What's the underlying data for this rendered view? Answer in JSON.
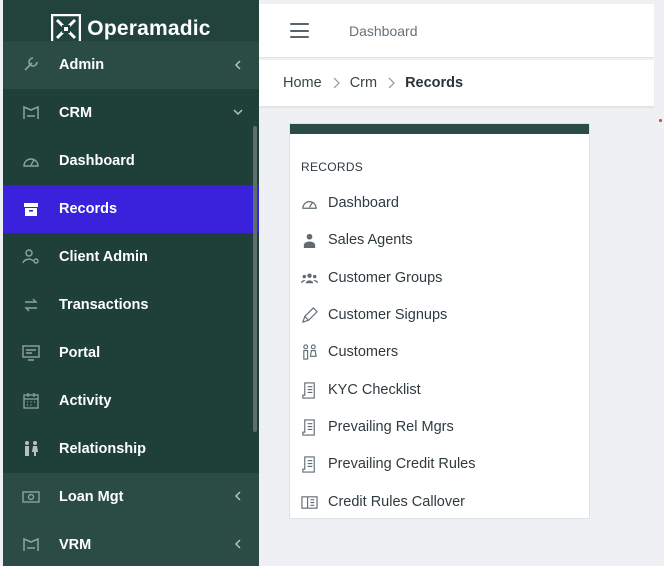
{
  "brand": {
    "name": "Operamadic"
  },
  "colors": {
    "sidebar_bg": "#1f3f39",
    "active_bg": "#3a21dc",
    "accent_bar": "#2a4c45"
  },
  "sidebar": {
    "items": [
      {
        "label": "Admin",
        "icon": "wrench-icon",
        "chevron": "left"
      },
      {
        "label": "CRM",
        "icon": "crm-icon",
        "chevron": "down"
      },
      {
        "label": "Dashboard",
        "icon": "gauge-icon"
      },
      {
        "label": "Records",
        "icon": "archive-icon",
        "active": true
      },
      {
        "label": "Client Admin",
        "icon": "user-gear-icon"
      },
      {
        "label": "Transactions",
        "icon": "arrows-exchange-icon"
      },
      {
        "label": "Portal",
        "icon": "portal-icon"
      },
      {
        "label": "Activity",
        "icon": "calendar-icon"
      },
      {
        "label": "Relationship",
        "icon": "people-icon"
      },
      {
        "label": "Loan Mgt",
        "icon": "cash-icon",
        "chevron": "left"
      },
      {
        "label": "VRM",
        "icon": "vrm-icon",
        "chevron": "left"
      }
    ]
  },
  "topbar": {
    "title": "Dashboard"
  },
  "breadcrumb": {
    "home": "Home",
    "crm": "Crm",
    "current": "Records"
  },
  "records_card": {
    "heading": "RECORDS",
    "items": [
      {
        "label": "Dashboard",
        "icon": "gauge-icon"
      },
      {
        "label": "Sales Agents",
        "icon": "agent-icon"
      },
      {
        "label": "Customer Groups",
        "icon": "group-icon"
      },
      {
        "label": "Customer Signups",
        "icon": "pen-icon"
      },
      {
        "label": "Customers",
        "icon": "customers-icon"
      },
      {
        "label": "KYC Checklist",
        "icon": "document-icon"
      },
      {
        "label": "Prevailing Rel Mgrs",
        "icon": "document-icon"
      },
      {
        "label": "Prevailing Credit Rules",
        "icon": "document-icon"
      },
      {
        "label": "Credit Rules Callover",
        "icon": "book-icon"
      }
    ]
  }
}
